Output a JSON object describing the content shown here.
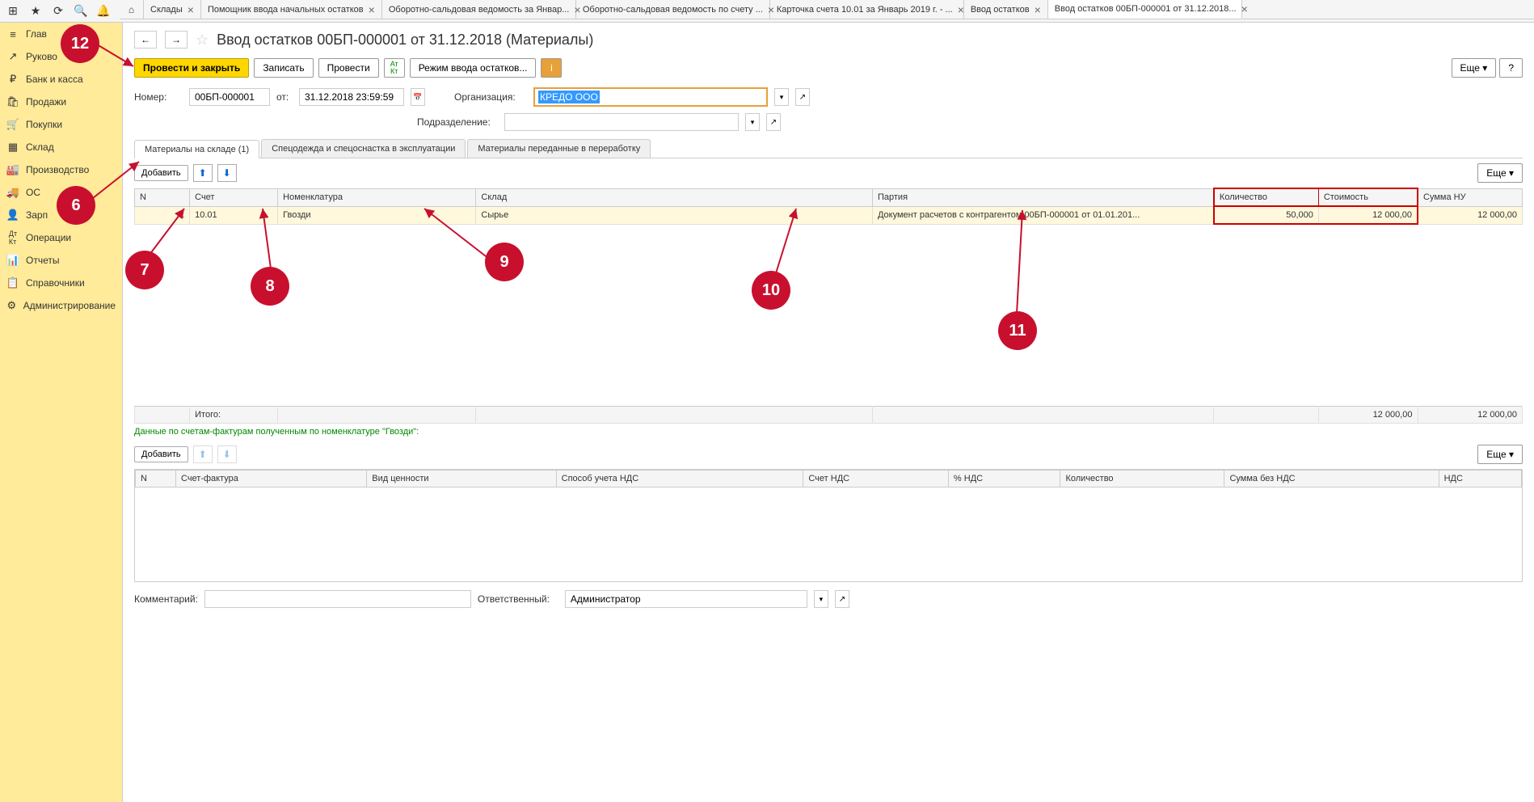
{
  "topIcons": [
    "⊞",
    "★",
    "⟳",
    "🔍",
    "🔔"
  ],
  "tabs": [
    {
      "label": "Склады"
    },
    {
      "label": "Помощник ввода начальных остатков"
    },
    {
      "label": "Оборотно-сальдовая ведомость за Январ..."
    },
    {
      "label": "Оборотно-сальдовая ведомость по счету ..."
    },
    {
      "label": "Карточка счета 10.01 за Январь 2019 г. - ..."
    },
    {
      "label": "Ввод остатков"
    },
    {
      "label": "Ввод остатков 00БП-000001 от 31.12.2018...",
      "active": true
    }
  ],
  "sidebar": [
    {
      "icon": "≡",
      "label": "Глав"
    },
    {
      "icon": "📈",
      "label": "Руково"
    },
    {
      "icon": "₽",
      "label": "Банк и касса"
    },
    {
      "icon": "🛍",
      "label": "Продажи"
    },
    {
      "icon": "🛒",
      "label": "Покупки"
    },
    {
      "icon": "▦",
      "label": "Склад"
    },
    {
      "icon": "🏭",
      "label": "Производство"
    },
    {
      "icon": "🚚",
      "label": "ОС"
    },
    {
      "icon": "👤",
      "label": "Зарп"
    },
    {
      "icon": "Дт",
      "label": "Операции"
    },
    {
      "icon": "📊",
      "label": "Отчеты"
    },
    {
      "icon": "📋",
      "label": "Справочники"
    },
    {
      "icon": "⚙",
      "label": "Администрирование"
    }
  ],
  "docTitle": "Ввод остатков 00БП-000001 от 31.12.2018 (Материалы)",
  "actions": {
    "postClose": "Провести и закрыть",
    "write": "Записать",
    "post": "Провести",
    "mode": "Режим ввода остатков...",
    "more": "Еще"
  },
  "fields": {
    "numberLabel": "Номер:",
    "numberValue": "00БП-000001",
    "dateLabel": "от:",
    "dateValue": "31.12.2018 23:59:59",
    "orgLabel": "Организация:",
    "orgValue": "КРЕДО ООО",
    "deptLabel": "Подразделение:",
    "deptValue": ""
  },
  "innerTabs": [
    {
      "label": "Материалы на складе (1)",
      "active": true
    },
    {
      "label": "Спецодежда и спецоснастка в эксплуатации"
    },
    {
      "label": "Материалы переданные в переработку"
    }
  ],
  "tableToolbar": {
    "add": "Добавить"
  },
  "mainTable": {
    "headers": [
      "N",
      "Счет",
      "Номенклатура",
      "Склад",
      "Партия",
      "Количество",
      "Стоимость",
      "Сумма НУ"
    ],
    "row": {
      "n": "1",
      "account": "10.01",
      "item": "Гвозди",
      "warehouse": "Сырье",
      "batch": "Документ расчетов с контрагентом 00БП-000001 от 01.01.201...",
      "qty": "50,000",
      "cost": "12 000,00",
      "sumNU": "12 000,00"
    },
    "totalLabel": "Итого:",
    "totalCost": "12 000,00",
    "totalNU": "12 000,00"
  },
  "invoiceHint": "Данные по счетам-фактурам полученным по номенклатуре \"Гвозди\":",
  "invoiceTable": {
    "headers": [
      "N",
      "Счет-фактура",
      "Вид ценности",
      "Способ учета НДС",
      "Счет НДС",
      "% НДС",
      "Количество",
      "Сумма без НДС",
      "НДС"
    ]
  },
  "footer": {
    "commentLabel": "Комментарий:",
    "commentValue": "",
    "respLabel": "Ответственный:",
    "respValue": "Администратор"
  },
  "annotations": {
    "6": "6",
    "7": "7",
    "8": "8",
    "9": "9",
    "10": "10",
    "11": "11",
    "12": "12"
  }
}
